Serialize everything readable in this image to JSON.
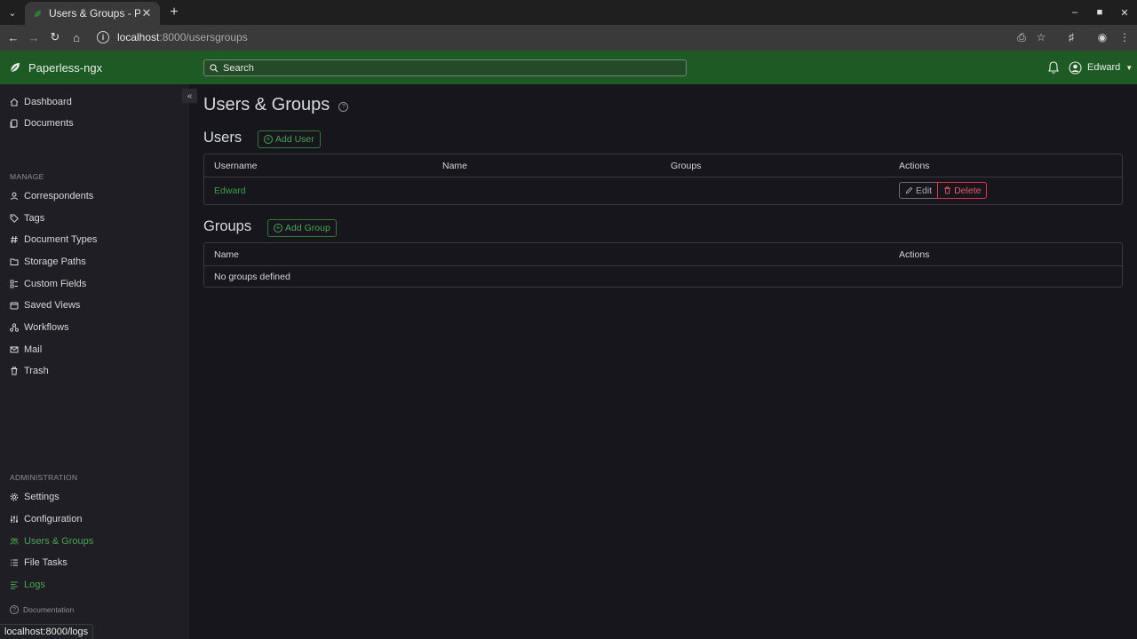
{
  "browser": {
    "tab_title": "Users & Groups - Paperless-ngx",
    "url_host": "localhost",
    "url_path": ":8000/usersgroups",
    "status_url": "localhost:8000/logs"
  },
  "app": {
    "brand": "Paperless-ngx",
    "search_placeholder": "Search",
    "user": "Edward",
    "accent_color": "#1e5a24"
  },
  "sidebar": {
    "top_items": [
      {
        "label": "Dashboard",
        "icon": "house-icon"
      },
      {
        "label": "Documents",
        "icon": "files-icon"
      }
    ],
    "manage_heading": "MANAGE",
    "manage_items": [
      {
        "label": "Correspondents",
        "icon": "person-icon"
      },
      {
        "label": "Tags",
        "icon": "tag-icon"
      },
      {
        "label": "Document Types",
        "icon": "hash-icon"
      },
      {
        "label": "Storage Paths",
        "icon": "folder-icon"
      },
      {
        "label": "Custom Fields",
        "icon": "ui-radios-icon"
      },
      {
        "label": "Saved Views",
        "icon": "window-stack-icon"
      },
      {
        "label": "Workflows",
        "icon": "diagram-icon"
      },
      {
        "label": "Mail",
        "icon": "envelope-icon"
      },
      {
        "label": "Trash",
        "icon": "trash-icon"
      }
    ],
    "admin_heading": "ADMINISTRATION",
    "admin_items": [
      {
        "label": "Settings",
        "icon": "gear-icon"
      },
      {
        "label": "Configuration",
        "icon": "sliders-icon"
      },
      {
        "label": "Users & Groups",
        "icon": "people-icon",
        "active": true
      },
      {
        "label": "File Tasks",
        "icon": "list-task-icon"
      },
      {
        "label": "Logs",
        "icon": "text-left-icon",
        "active": true
      }
    ],
    "documentation": "Documentation"
  },
  "main": {
    "title": "Users & Groups",
    "users": {
      "heading": "Users",
      "add_label": "Add User",
      "columns": [
        "Username",
        "Name",
        "Groups",
        "Actions"
      ],
      "rows": [
        {
          "username": "Edward",
          "name": "",
          "groups": "",
          "edit": "Edit",
          "delete": "Delete"
        }
      ]
    },
    "groups": {
      "heading": "Groups",
      "add_label": "Add Group",
      "columns": [
        "Name",
        "Actions"
      ],
      "empty": "No groups defined"
    }
  }
}
